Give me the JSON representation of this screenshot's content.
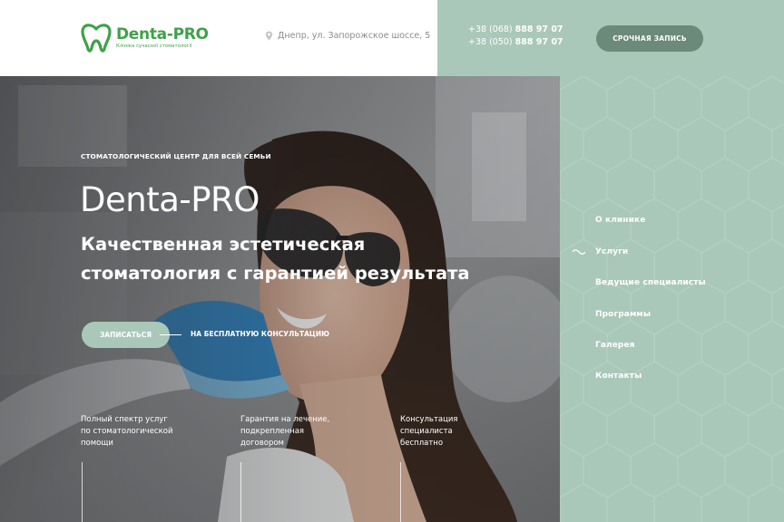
{
  "header": {
    "logo": {
      "name": "Denta-PRO",
      "tagline": "Клініка сучасної стоматології"
    },
    "address": "Днепр, ул. Запорожское шоссе, 5",
    "phones": [
      {
        "prefix": "+38 (068)",
        "number": "888 97 07"
      },
      {
        "prefix": "+38 (050)",
        "number": "888 97 07"
      }
    ],
    "urgent_button": "СРОЧНАЯ ЗАПИСЬ"
  },
  "hero": {
    "tag": "СТОМАТОЛОГИЧЕСКИЙ ЦЕНТР ДЛЯ ВСЕЙ СЕМЬИ",
    "title": "Denta-PRO",
    "subtitle_line1": "Качественная эстетическая",
    "subtitle_line2": "стоматология с гарантией результата",
    "signup_button": "ЗАПИСАТЬСЯ",
    "consult_link": "НА БЕСПЛАТНУЮ КОНСУЛЬТАЦИЮ",
    "features": [
      {
        "line1": "Полный спектр услуг",
        "line2": "по стоматологической",
        "line3": "помощи"
      },
      {
        "line1": "Гарантия на лечение,",
        "line2": "подкрепленная",
        "line3": "договором"
      },
      {
        "line1": "Консультация",
        "line2": "специалиста",
        "line3": "бесплатно"
      }
    ]
  },
  "nav": {
    "items": [
      {
        "label": "О клинике",
        "active": false
      },
      {
        "label": "Услуги",
        "active": true
      },
      {
        "label": "Ведущие специалисты",
        "active": false
      },
      {
        "label": "Программы",
        "active": false
      },
      {
        "label": "Галерея",
        "active": false
      },
      {
        "label": "Контакты",
        "active": false
      }
    ]
  },
  "colors": {
    "brand_green": "#3fa14a",
    "sage": "#a9c8b9",
    "sage_dark": "#6b8a7a"
  }
}
